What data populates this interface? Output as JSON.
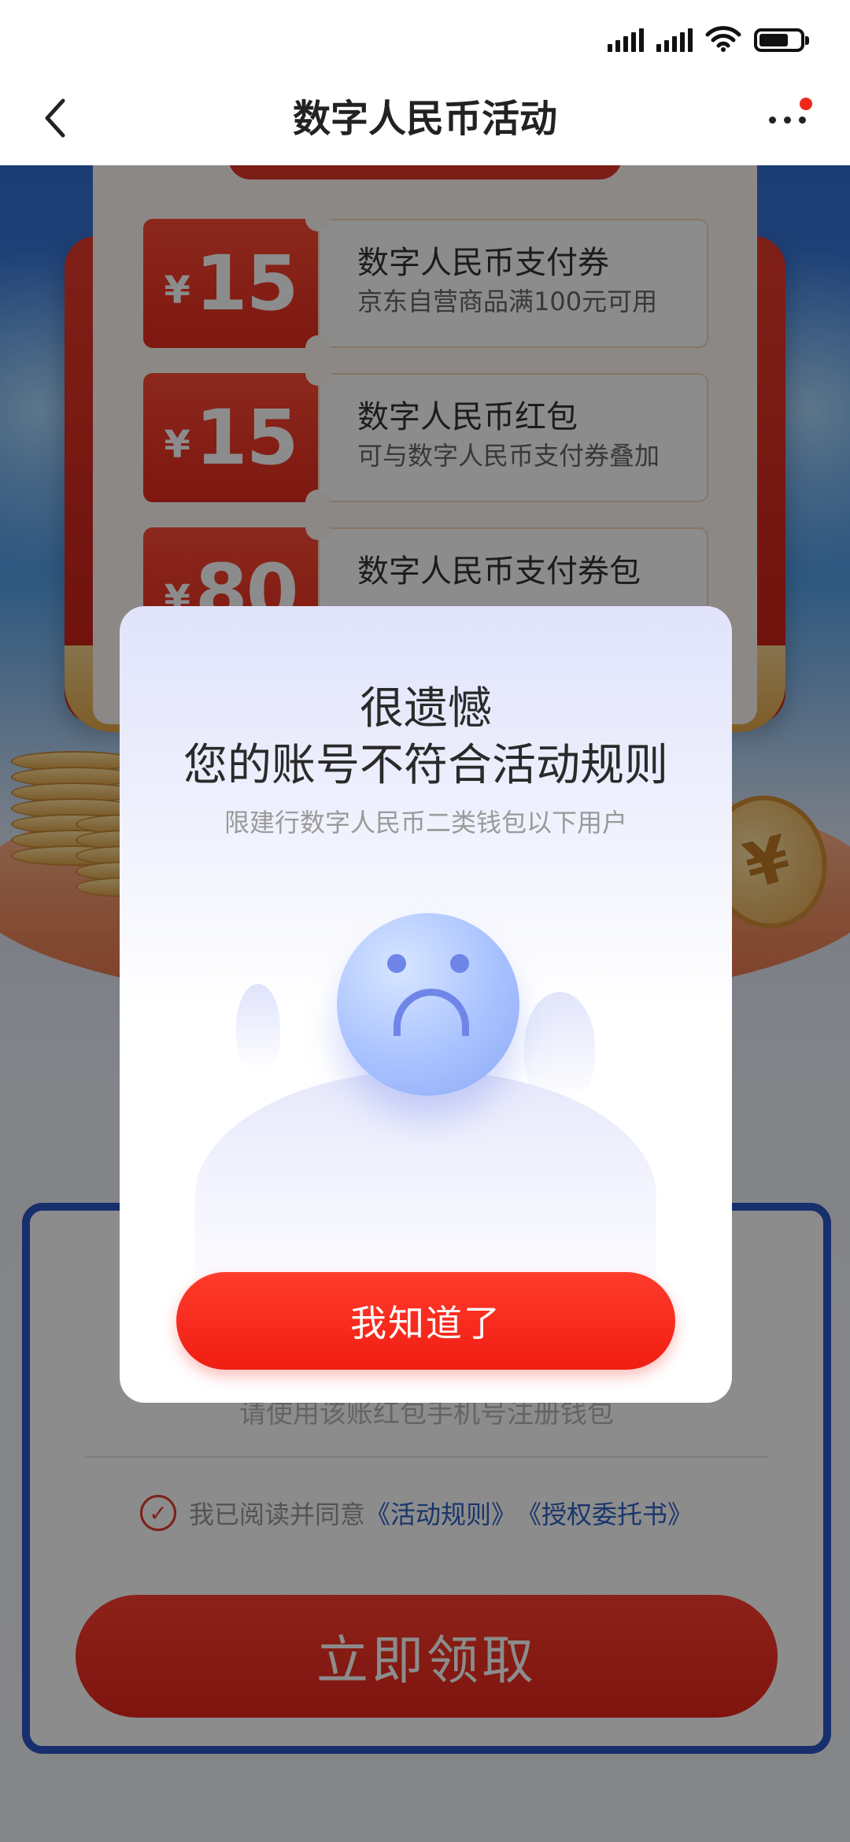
{
  "nav": {
    "title": "数字人民币活动",
    "back_icon": "chevron-left-icon",
    "more_icon": "more-dots-icon",
    "has_notification_dot": true
  },
  "coupons": [
    {
      "currency": "¥",
      "amount": "15",
      "title": "数字人民币支付券",
      "desc": "京东自营商品满100元可用"
    },
    {
      "currency": "¥",
      "amount": "15",
      "title": "数字人民币红包",
      "desc": "可与数字人民币支付券叠加"
    },
    {
      "currency": "¥",
      "amount": "80",
      "title": "数字人民币支付券包",
      "desc": ""
    }
  ],
  "form": {
    "hint": "请使用该账红包手机号注册钱包",
    "agree_prefix": "我已阅读并同意",
    "agree_link_rules": "《活动规则》",
    "agree_link_auth": "《授权委托书》",
    "claim_button": "立即领取"
  },
  "modal": {
    "title_line1": "很遗憾",
    "title_line2": "您的账号不符合活动规则",
    "subtitle": "限建行数字人民币二类钱包以下用户",
    "ok_button": "我知道了"
  },
  "colors": {
    "accent_red": "#f01e12",
    "link_blue": "#2f62c4",
    "frame_blue": "#2d57c6"
  }
}
